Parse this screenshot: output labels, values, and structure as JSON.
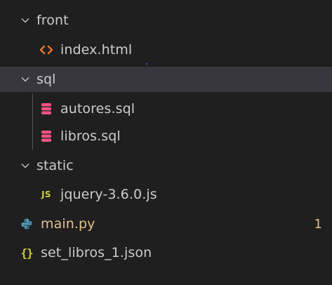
{
  "tree": {
    "front": {
      "label": "front",
      "icon": "chevron-down-icon"
    },
    "index_html": {
      "label": "index.html",
      "icon": "html-file-icon"
    },
    "sql": {
      "label": "sql",
      "icon": "chevron-down-icon"
    },
    "autores_sql": {
      "label": "autores.sql",
      "icon": "database-file-icon"
    },
    "libros_sql": {
      "label": "libros.sql",
      "icon": "database-file-icon"
    },
    "static": {
      "label": "static",
      "icon": "chevron-down-icon"
    },
    "jquery_js": {
      "label": "jquery-3.6.0.js",
      "icon": "javascript-file-icon",
      "icon_text": "JS"
    },
    "main_py": {
      "label": "main.py",
      "icon": "python-file-icon",
      "badge": "1"
    },
    "set_libros_json": {
      "label": "set_libros_1.json",
      "icon": "json-file-icon",
      "icon_text": "{}"
    }
  },
  "colors": {
    "background": "#1f1f1f",
    "selected_row": "#37373d",
    "text": "#cccccc",
    "html_icon": "#e37933",
    "database_icon": "#f55385",
    "javascript_icon": "#cbcb41",
    "python_icon": "#519aba",
    "json_icon": "#cbcb41",
    "modified": "#e2c08d"
  }
}
